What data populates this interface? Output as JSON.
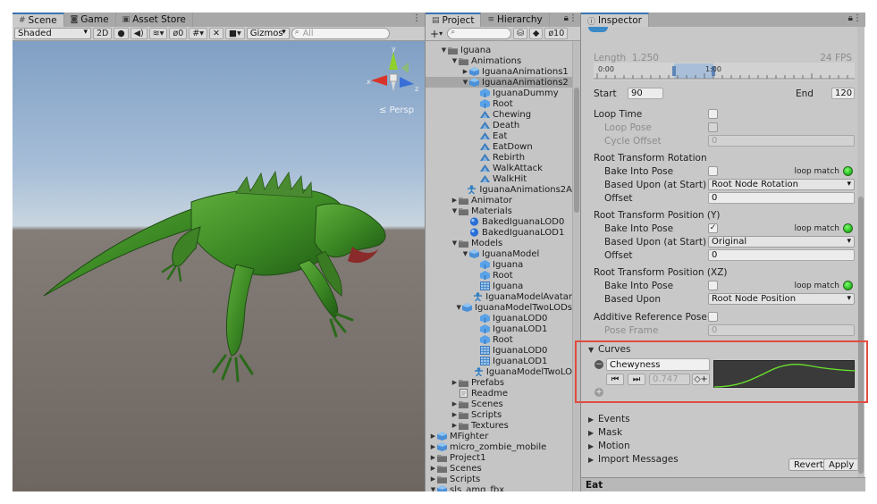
{
  "scene": {
    "tabs": [
      {
        "label": "Scene",
        "icon": "hash-icon"
      },
      {
        "label": "Game",
        "icon": "gamepad-icon"
      },
      {
        "label": "Asset Store",
        "icon": "bag-icon"
      }
    ],
    "shading_mode": "Shaded",
    "toggle_2d": "2D",
    "hidden_count": "0",
    "gizmos_label": "Gizmos",
    "search_placeholder": "All",
    "gizmo_axes": {
      "x": "x",
      "y": "y",
      "z": "z"
    },
    "view_label": "Persp",
    "colors": {
      "axis_x": "#d8342a",
      "axis_y": "#8fd12c",
      "axis_z": "#3a6fd8",
      "iguana": "#3f8a26"
    }
  },
  "project": {
    "tabs": [
      {
        "label": "Project",
        "icon": "folder-icon"
      },
      {
        "label": "Hierarchy",
        "icon": "list-icon"
      }
    ],
    "add_label": "+",
    "count_label": "10",
    "tree": [
      {
        "label": "Iguana",
        "depth": 1,
        "icon": "folder",
        "arrow": "open"
      },
      {
        "label": "Animations",
        "depth": 2,
        "icon": "folder",
        "arrow": "open"
      },
      {
        "label": "IguanaAnimations1",
        "depth": 3,
        "icon": "prefab",
        "arrow": "closed"
      },
      {
        "label": "IguanaAnimations2",
        "depth": 3,
        "icon": "prefab",
        "arrow": "open",
        "selected": true
      },
      {
        "label": "IguanaDummy",
        "depth": 4,
        "icon": "mesh"
      },
      {
        "label": "Root",
        "depth": 4,
        "icon": "mesh"
      },
      {
        "label": "Chewing",
        "depth": 4,
        "icon": "clip"
      },
      {
        "label": "Death",
        "depth": 4,
        "icon": "clip"
      },
      {
        "label": "Eat",
        "depth": 4,
        "icon": "clip"
      },
      {
        "label": "EatDown",
        "depth": 4,
        "icon": "clip"
      },
      {
        "label": "Rebirth",
        "depth": 4,
        "icon": "clip"
      },
      {
        "label": "WalkAttack",
        "depth": 4,
        "icon": "clip"
      },
      {
        "label": "WalkHit",
        "depth": 4,
        "icon": "clip"
      },
      {
        "label": "IguanaAnimations2A",
        "depth": 4,
        "icon": "avatar"
      },
      {
        "label": "Animator",
        "depth": 2,
        "icon": "folder",
        "arrow": "closed"
      },
      {
        "label": "Materials",
        "depth": 2,
        "icon": "folder",
        "arrow": "open"
      },
      {
        "label": "BakedIguanaLOD0",
        "depth": 3,
        "icon": "sphere"
      },
      {
        "label": "BakedIguanaLOD1",
        "depth": 3,
        "icon": "sphere"
      },
      {
        "label": "Models",
        "depth": 2,
        "icon": "folder",
        "arrow": "open"
      },
      {
        "label": "IguanaModel",
        "depth": 3,
        "icon": "prefab",
        "arrow": "open"
      },
      {
        "label": "Iguana",
        "depth": 4,
        "icon": "mesh"
      },
      {
        "label": "Root",
        "depth": 4,
        "icon": "mesh"
      },
      {
        "label": "Iguana",
        "depth": 4,
        "icon": "grid"
      },
      {
        "label": "IguanaModelAvatar",
        "depth": 4,
        "icon": "avatar"
      },
      {
        "label": "IguanaModelTwoLODs",
        "depth": 3,
        "icon": "prefab",
        "arrow": "open"
      },
      {
        "label": "IguanaLOD0",
        "depth": 4,
        "icon": "mesh"
      },
      {
        "label": "IguanaLOD1",
        "depth": 4,
        "icon": "mesh"
      },
      {
        "label": "Root",
        "depth": 4,
        "icon": "mesh"
      },
      {
        "label": "IguanaLOD0",
        "depth": 4,
        "icon": "grid"
      },
      {
        "label": "IguanaLOD1",
        "depth": 4,
        "icon": "grid"
      },
      {
        "label": "IguanaModelTwoLO",
        "depth": 4,
        "icon": "avatar"
      },
      {
        "label": "Prefabs",
        "depth": 2,
        "icon": "folder",
        "arrow": "closed"
      },
      {
        "label": "Readme",
        "depth": 2,
        "icon": "doc"
      },
      {
        "label": "Scenes",
        "depth": 2,
        "icon": "folder",
        "arrow": "closed"
      },
      {
        "label": "Scripts",
        "depth": 2,
        "icon": "folder",
        "arrow": "closed"
      },
      {
        "label": "Textures",
        "depth": 2,
        "icon": "folder",
        "arrow": "closed"
      },
      {
        "label": "MFighter",
        "depth": 0,
        "icon": "prefab",
        "arrow": "closed"
      },
      {
        "label": "micro_zombie_mobile",
        "depth": 0,
        "icon": "prefab",
        "arrow": "closed"
      },
      {
        "label": "Project1",
        "depth": 0,
        "icon": "folder",
        "arrow": "closed"
      },
      {
        "label": "Scenes",
        "depth": 0,
        "icon": "folder",
        "arrow": "closed"
      },
      {
        "label": "Scripts",
        "depth": 0,
        "icon": "folder",
        "arrow": "closed"
      },
      {
        "label": "sls_amg_fbx",
        "depth": 0,
        "icon": "prefab",
        "arrow": "open"
      }
    ]
  },
  "inspector": {
    "tab": {
      "label": "Inspector",
      "icon": "info-icon"
    },
    "length_label": "Length",
    "length_value": "1.250",
    "fps": "24 FPS",
    "timeline_ticks": [
      "0:00",
      "1:00"
    ],
    "start_label": "Start",
    "start_value": "90",
    "end_label": "End",
    "end_value": "120",
    "loop_time": "Loop Time",
    "loop_pose": "Loop Pose",
    "cycle_offset": "Cycle Offset",
    "cycle_offset_value": "0",
    "rot_header": "Root Transform Rotation",
    "bake_into_pose": "Bake Into Pose",
    "based_upon_start": "Based Upon (at Start)",
    "offset": "Offset",
    "rot_based_value": "Root Node Rotation",
    "rot_offset_value": "0",
    "posy_header": "Root Transform Position (Y)",
    "posy_based_value": "Original",
    "posy_offset_value": "0",
    "posxz_header": "Root Transform Position (XZ)",
    "based_upon": "Based Upon",
    "posxz_based_value": "Root Node Position",
    "loop_match": "loop match",
    "additive": "Additive Reference Pose",
    "pose_frame": "Pose Frame",
    "pose_frame_value": "0",
    "curves": "Curves",
    "curve_name": "Chewyness",
    "curve_value": "0.747",
    "events": "Events",
    "mask": "Mask",
    "motion": "Motion",
    "import_messages": "Import Messages",
    "revert": "Revert",
    "apply": "Apply",
    "footer": "Eat",
    "colors": {
      "highlight": "#e24b40",
      "loop_match": "#2ec225",
      "curve": "#67e22c"
    }
  }
}
